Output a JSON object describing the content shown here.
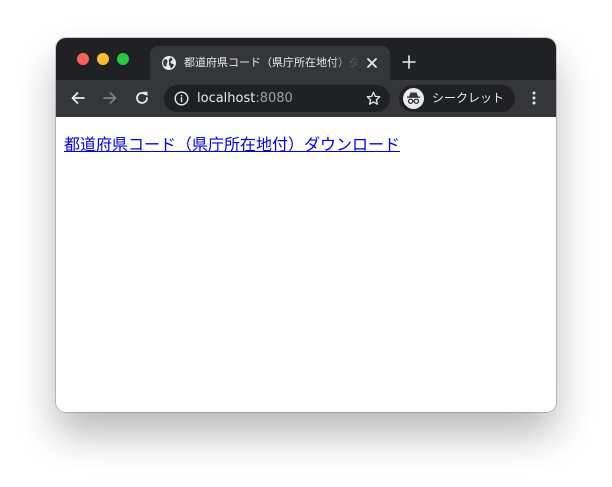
{
  "window": {
    "controls": [
      "close",
      "minimize",
      "zoom"
    ]
  },
  "tab": {
    "title": "都道府県コード（県庁所在地付）ダウンロード",
    "favicon": "globe-icon",
    "close_icon": "close-icon"
  },
  "new_tab_icon": "plus-icon",
  "toolbar": {
    "back_icon": "arrow-left-icon",
    "forward_icon": "arrow-right-icon",
    "reload_icon": "reload-icon",
    "address": {
      "host": "localhost",
      "port": ":8080",
      "info_icon": "info-icon",
      "bookmark_icon": "star-icon"
    },
    "incognito": {
      "label": "シークレット",
      "icon": "incognito-icon"
    },
    "menu_icon": "more-vert-icon"
  },
  "page": {
    "link_text": "都道府県コード（県庁所在地付）ダウンロード"
  },
  "colors": {
    "tabstrip": "#202124",
    "toolbar": "#35363a",
    "link": "#0000ee",
    "traffic_red": "#ff5f57",
    "traffic_yellow": "#febc2e",
    "traffic_green": "#28c840"
  }
}
